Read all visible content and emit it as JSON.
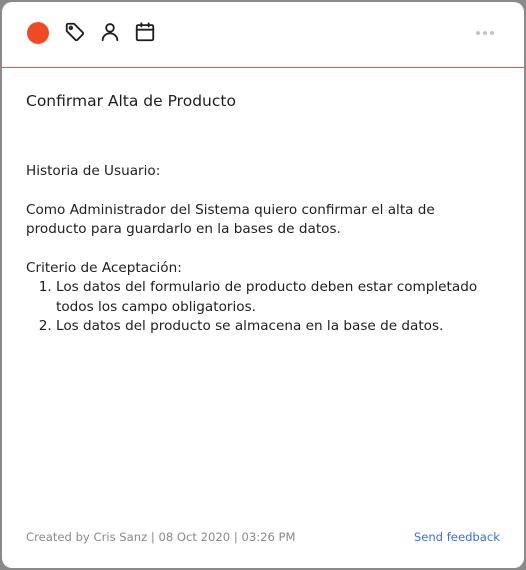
{
  "toolbar": {
    "status_color": "#f04a24",
    "icons": [
      "tag-icon",
      "user-icon",
      "calendar-icon",
      "more-options-icon"
    ]
  },
  "card": {
    "title": "Confirmar Alta de Producto",
    "story_heading": "Historia de Usuario:",
    "story_text": "Como Administrador del Sistema quiero confirmar el alta de producto para guardarlo en la bases de datos.",
    "criteria_heading": "Criterio de Aceptación:",
    "criteria": [
      "Los datos del formulario de producto deben estar completado todos los campo obligatorios.",
      "Los datos del producto se almacena en la base de datos."
    ]
  },
  "footer": {
    "created_label": "Created by",
    "author": "Cris Sanz",
    "date": "08 Oct 2020",
    "time": "03:26 PM",
    "feedback_link": "Send feedback"
  }
}
